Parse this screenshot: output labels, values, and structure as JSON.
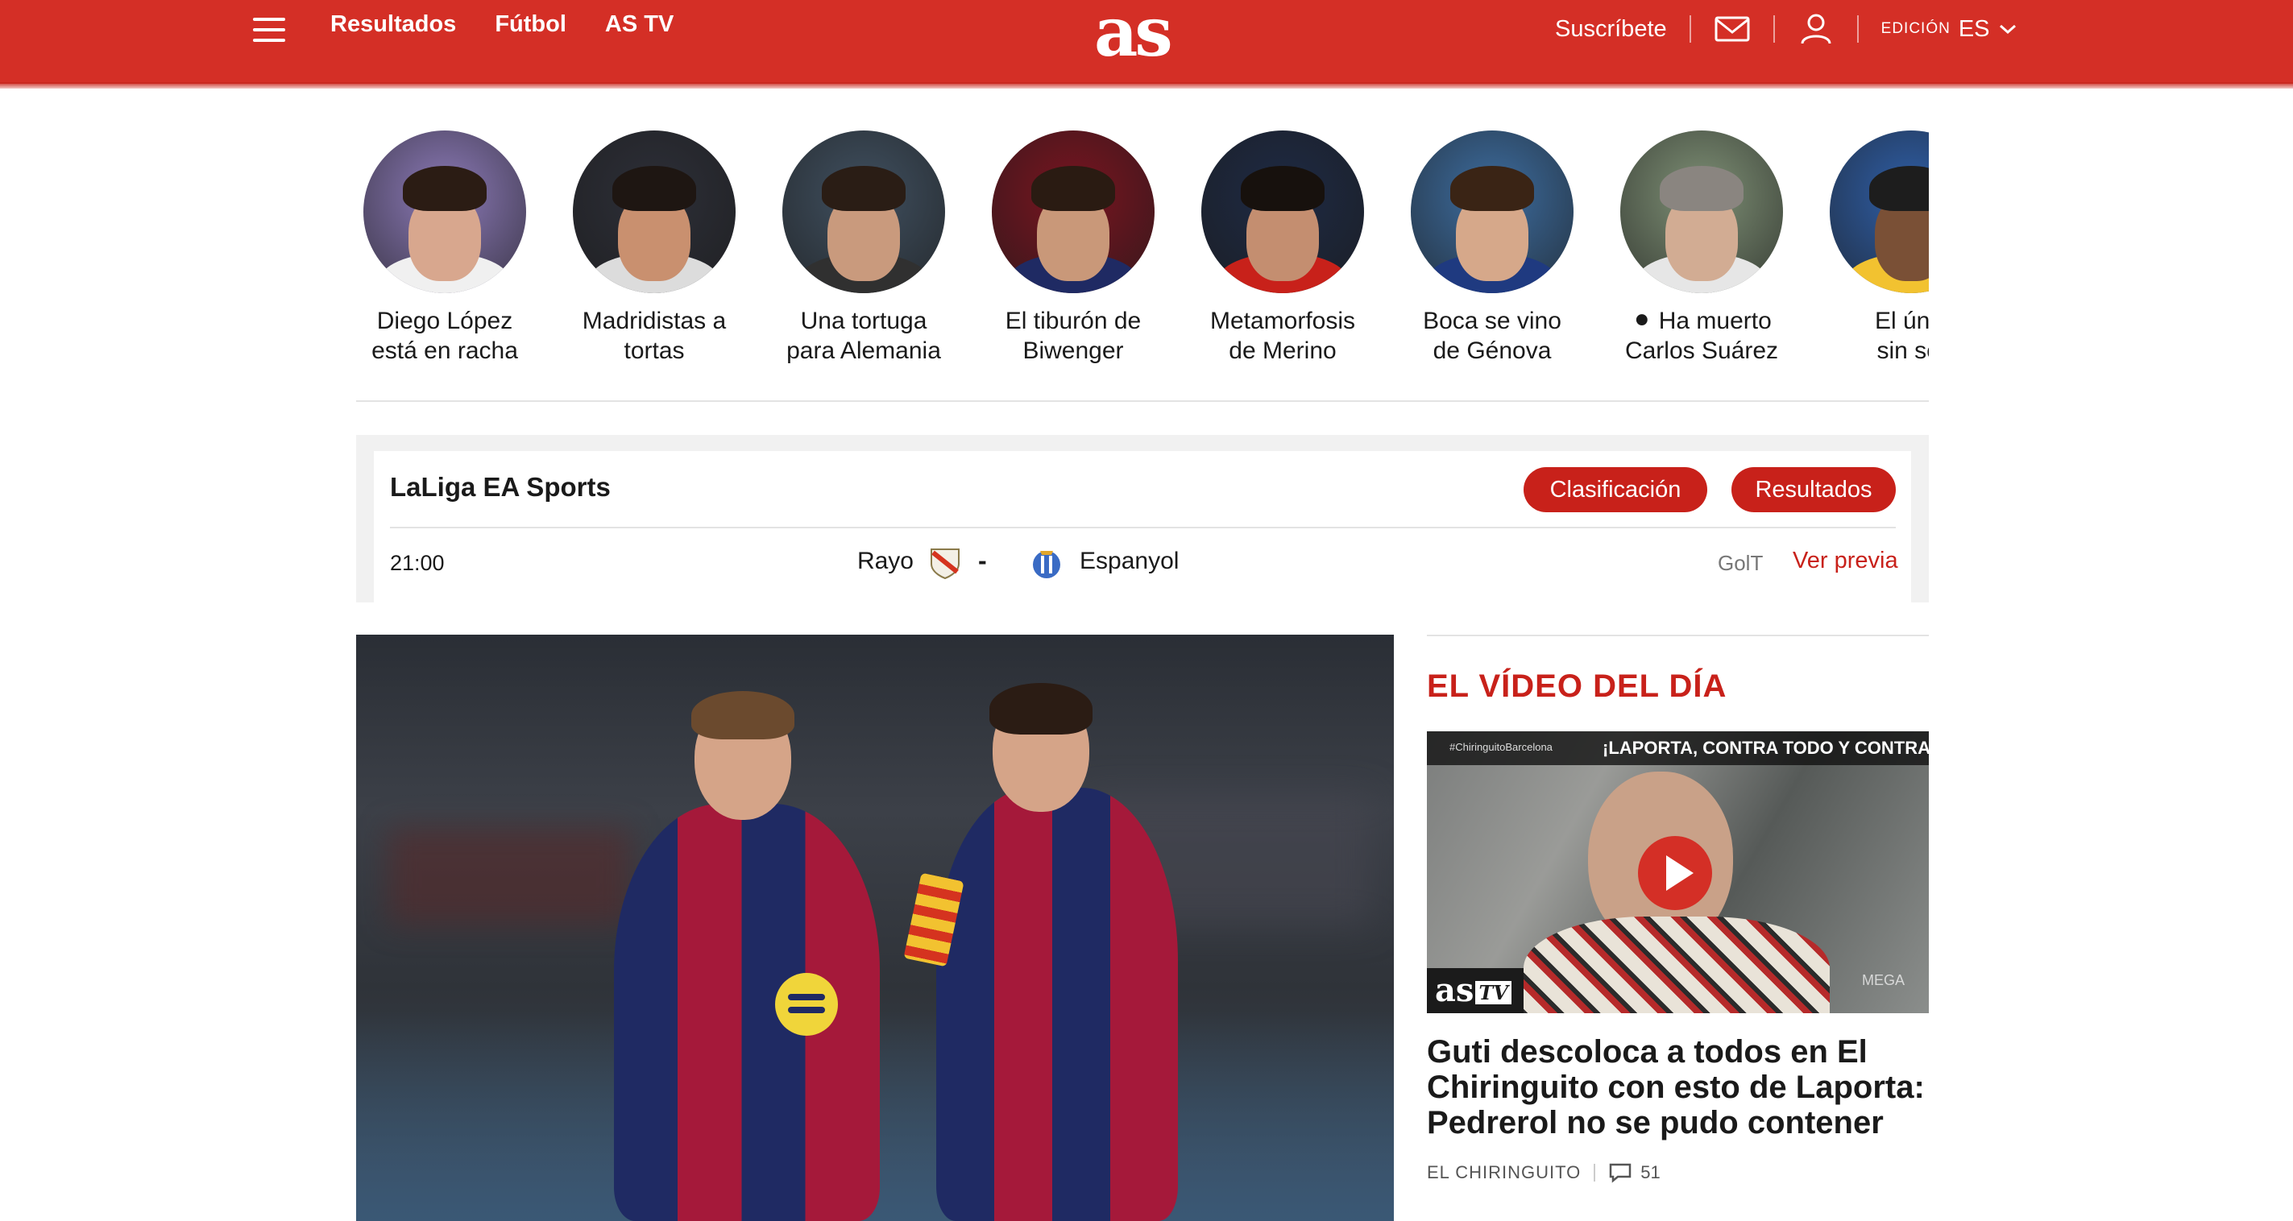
{
  "header": {
    "nav": [
      "Resultados",
      "Fútbol",
      "AS TV"
    ],
    "logo": "as",
    "subscribe": "Suscríbete",
    "edition_label": "EDICIÓN",
    "edition_value": "ES",
    "colors": {
      "brand": "#d42f26",
      "accent": "#c8211a"
    }
  },
  "stories": [
    {
      "label": "Diego López\nestá en racha",
      "bg": "#8c7ab8",
      "skin": "#d8a78e",
      "hair": "#2b1c14",
      "shirt": "#f0f0f0"
    },
    {
      "label": "Madridistas a\ntortas",
      "bg": "#2d2f38",
      "skin": "#c9906f",
      "hair": "#1e1612",
      "shirt": "#dcdcdc"
    },
    {
      "label": "Una tortuga\npara Alemania",
      "bg": "#405060",
      "skin": "#c99a7d",
      "hair": "#2a1d15",
      "shirt": "#303030"
    },
    {
      "label": "El tiburón de\nBiwenger",
      "bg": "#7a1420",
      "skin": "#c99879",
      "hair": "#2a1b12",
      "shirt": "#1f2a63"
    },
    {
      "label": "Metamorfosis\nde Merino",
      "bg": "#1e2a44",
      "skin": "#c48e70",
      "hair": "#17110d",
      "shirt": "#c8211a"
    },
    {
      "label": "Boca se vino\nde Génova",
      "bg": "#3d6da0",
      "skin": "#d6a88a",
      "hair": "#3a2415",
      "shirt": "#1f3a80"
    },
    {
      "label": "⚫ Ha muerto\nCarlos Suárez",
      "bg": "#7f9176",
      "skin": "#d2ac93",
      "hair": "#8a8580",
      "shirt": "#e6e6e6"
    },
    {
      "label": "El únic\nsin sel",
      "bg": "#2f5fa8",
      "skin": "#7a5036",
      "hair": "#1d1d1d",
      "shirt": "#f2c230"
    }
  ],
  "league": {
    "title": "LaLiga EA Sports",
    "buttons": {
      "standings": "Clasificación",
      "results": "Resultados"
    },
    "match": {
      "time": "21:00",
      "home": "Rayo",
      "separator": "-",
      "away": "Espanyol",
      "broadcaster": "GolT",
      "preview": "Ver previa"
    }
  },
  "sidebar": {
    "section_title": "EL VÍDEO DEL DÍA",
    "video": {
      "tag": "#ChiringuitoBarcelona",
      "banner": "¡LAPORTA, CONTRA TODO Y CONTRA TODOS!",
      "channel_logo": "as",
      "channel_tv": "TV",
      "watermark": "MEGA"
    },
    "headline": "Guti descoloca a todos en El Chiringuito con esto de Laporta: Pedrerol no se pudo contener",
    "source": "EL CHIRINGUITO",
    "comments": "51"
  }
}
